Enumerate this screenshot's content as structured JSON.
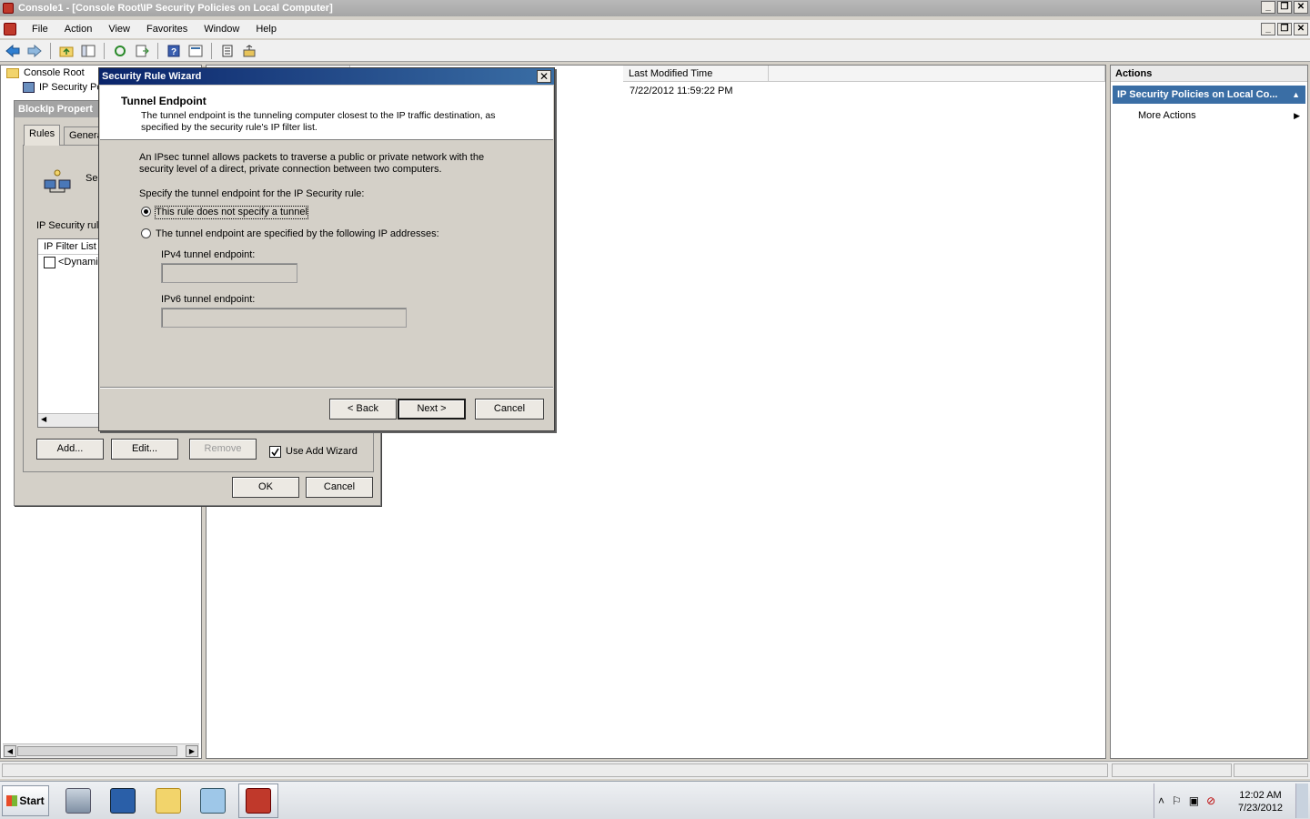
{
  "window": {
    "title": "Console1 - [Console Root\\IP Security Policies on Local Computer]",
    "buttons": [
      "_",
      "❐",
      "✕"
    ]
  },
  "menu": {
    "items": [
      "File",
      "Action",
      "View",
      "Favorites",
      "Window",
      "Help"
    ]
  },
  "toolbar": {
    "icons": [
      "back-arrow-icon",
      "forward-arrow-icon",
      "up-folder-icon",
      "show-hide-tree-icon",
      "refresh-icon",
      "export-list-icon",
      "help-icon",
      "properties-icon",
      "manage-filter-icon",
      "assign-policy-icon"
    ]
  },
  "tree": {
    "items": [
      "Console Root",
      "IP Security Po"
    ]
  },
  "list": {
    "columns": [
      "Last Modified Time"
    ],
    "rows": [
      {
        "last_modified": "7/22/2012 11:59:22 PM"
      }
    ]
  },
  "actions": {
    "title": "Actions",
    "section": "IP Security Policies on Local Co...",
    "more": "More Actions"
  },
  "props_dialog": {
    "title": "BlockIp Propert",
    "tabs": [
      "Rules",
      "Genera"
    ],
    "rules_icon_text": "Se",
    "list_label": "IP Security rule",
    "list_header": "IP Filter List",
    "list_row": "<Dynamic",
    "buttons": {
      "add": "Add...",
      "edit": "Edit...",
      "remove": "Remove",
      "ok": "OK",
      "cancel": "Cancel"
    },
    "use_wizard": "Use Add Wizard",
    "use_wizard_checked": true
  },
  "wizard": {
    "title": "Security Rule Wizard",
    "header_title": "Tunnel Endpoint",
    "header_subtitle": "The tunnel endpoint is the tunneling computer closest to the IP traffic destination, as specified by the security rule's IP filter list.",
    "description": "An IPsec tunnel allows packets to traverse a public or private network with the security level of a direct, private connection between two computers.",
    "prompt": "Specify the tunnel endpoint for the IP Security rule:",
    "option_no_tunnel": "This rule does not specify a tunnel",
    "option_tunnel": "The tunnel endpoint are specified by the following IP addresses:",
    "selected_option": "no_tunnel",
    "ipv4_label": "IPv4 tunnel endpoint:",
    "ipv4_value": "",
    "ipv6_label": "IPv6 tunnel endpoint:",
    "ipv6_value": "",
    "buttons": {
      "back": "< Back",
      "next": "Next >",
      "cancel": "Cancel"
    }
  },
  "taskbar": {
    "start": "Start",
    "apps": [
      "server-manager-icon",
      "powershell-icon",
      "explorer-icon",
      "notepad-icon",
      "mmc-console-icon"
    ],
    "time": "12:02 AM",
    "date": "7/23/2012"
  }
}
